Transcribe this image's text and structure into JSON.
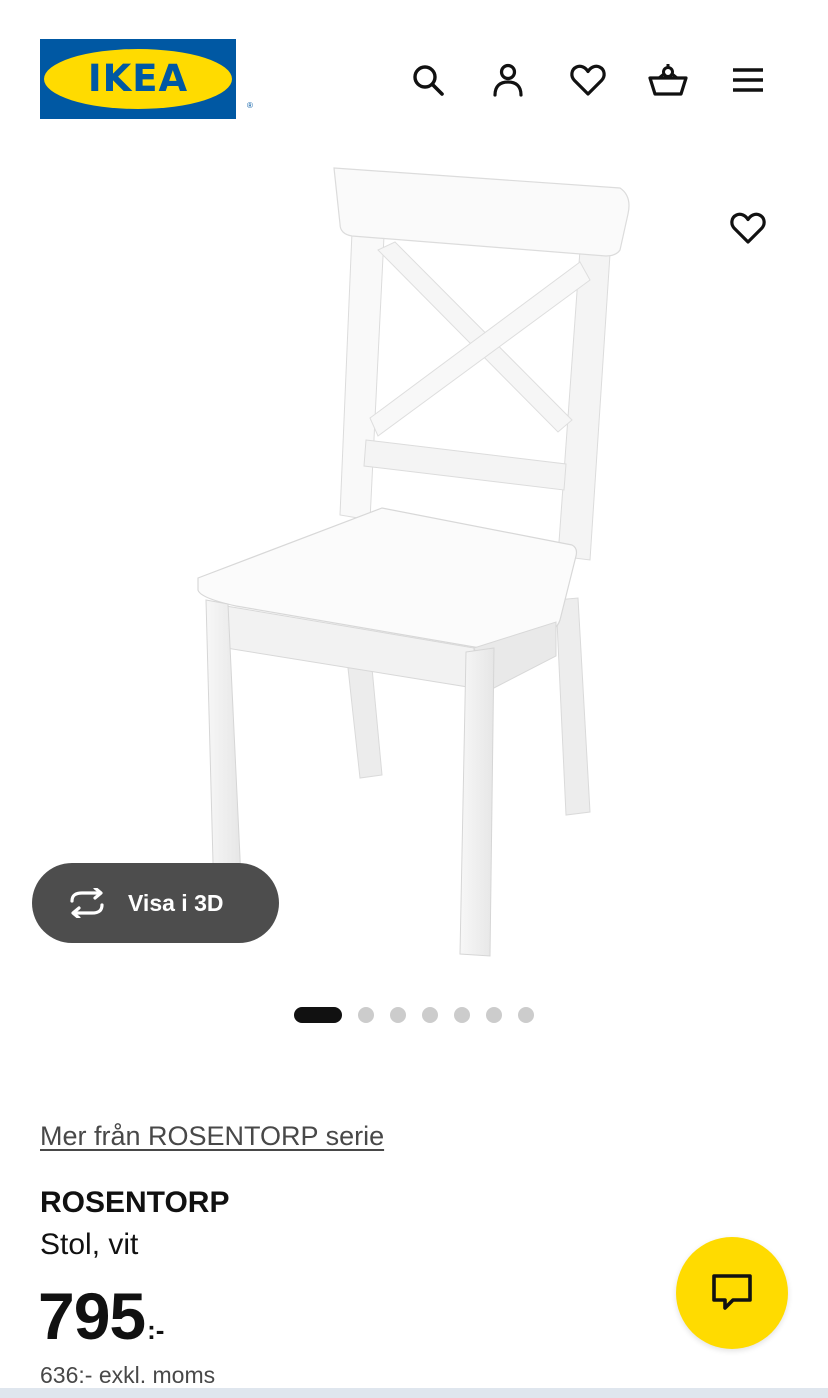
{
  "header": {
    "logo_text": "IKEA",
    "logo_reg": "®",
    "icons": [
      "search-icon",
      "account-icon",
      "heart-icon",
      "basket-icon",
      "menu-icon"
    ]
  },
  "gallery": {
    "image_alt": "ROSENTORP Stol, vit",
    "view3d_label": "Visa i 3D",
    "total_images": 7,
    "active_index": 0
  },
  "product": {
    "series_link": "Mer från ROSENTORP serie",
    "name": "ROSENTORP",
    "description": "Stol, vit",
    "price_integer": "795",
    "price_suffix": ":-",
    "price_excl_vat": "636:- exkl. moms"
  },
  "colors": {
    "brand_blue": "#0058a3",
    "brand_yellow": "#ffdb00",
    "dark_button": "#4d4d4d",
    "text": "#111111",
    "muted_text": "#484848"
  }
}
